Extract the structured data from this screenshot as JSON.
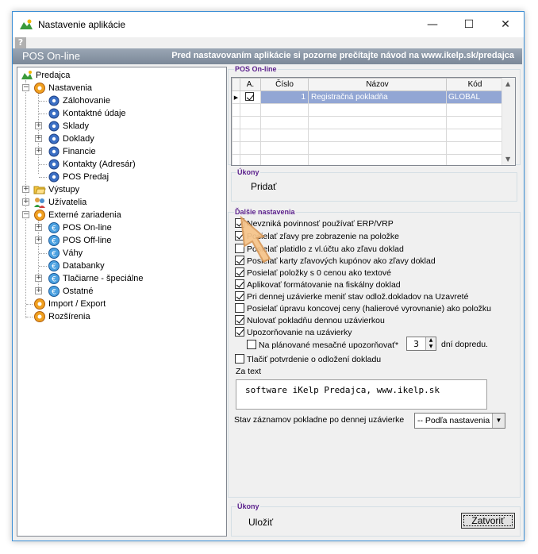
{
  "window": {
    "title": "Nastavenie aplikácie",
    "controls": {
      "minimize": "—",
      "maximize": "☐",
      "close": "✕"
    },
    "help": "?"
  },
  "banner": {
    "left": "POS On-line",
    "right": "Pred nastavovaním aplikácie si pozorne prečítajte návod na www.ikelp.sk/predajca"
  },
  "tree": [
    {
      "label": "Predajca"
    },
    {
      "label": "Nastavenia"
    },
    {
      "label": "Zálohovanie"
    },
    {
      "label": "Kontaktné údaje"
    },
    {
      "label": "Sklady"
    },
    {
      "label": "Doklady"
    },
    {
      "label": "Financie"
    },
    {
      "label": "Kontakty (Adresár)"
    },
    {
      "label": "POS Predaj"
    },
    {
      "label": "Výstupy"
    },
    {
      "label": "Užívatelia"
    },
    {
      "label": "Externé zariadenia"
    },
    {
      "label": "POS On-line"
    },
    {
      "label": "POS Off-line"
    },
    {
      "label": "Váhy"
    },
    {
      "label": "Databanky"
    },
    {
      "label": "Tlačiarne - špeciálne"
    },
    {
      "label": "Ostatné"
    },
    {
      "label": "Import / Export"
    },
    {
      "label": "Rozšírenia"
    }
  ],
  "pos_online": {
    "group_title": "POS On-line",
    "columns": [
      "A.",
      "Číslo",
      "Názov",
      "Kód"
    ],
    "rows": [
      {
        "cislo": "1",
        "nazov": "Registračná pokladňa",
        "kod": "GLOBAL",
        "active": true
      }
    ]
  },
  "ukony_top": {
    "title": "Úkony",
    "add": "Pridať"
  },
  "dalsie": {
    "title": "Ďalšie nastavenia",
    "options": [
      {
        "label": "Nevzniká povinnosť používať ERP/VRP",
        "checked": true
      },
      {
        "label": "Posielať zľavy pre zobrazenie na položke",
        "checked": true
      },
      {
        "label": "Posielať platidlo z vl.účtu ako zľavu doklad",
        "checked": false
      },
      {
        "label": "Posielať karty zľavových kupónov ako zľavy doklad",
        "checked": true
      },
      {
        "label": "Posielať položky s 0 cenou ako textové",
        "checked": true
      },
      {
        "label": "Aplikovať formátovanie na fiskálny doklad",
        "checked": true
      },
      {
        "label": "Pri dennej uzávierke meniť stav odlož.dokladov na Uzavreté",
        "checked": true
      },
      {
        "label": "Posielať úpravu koncovej ceny (halierové vyrovnanie) ako položku",
        "checked": false
      },
      {
        "label": "Nulovať pokladňu dennou uzávierkou",
        "checked": true
      },
      {
        "label": "Upozorňovanie na uzávierky",
        "checked": true
      }
    ],
    "monthly_label": "Na plánované mesačné upozorňovať*",
    "monthly_value": "3",
    "monthly_suffix": "dní dopredu.",
    "print_label": "Tlačiť potvrdenie o odložení dokladu",
    "za_text_label": "Za text",
    "za_text_value": "software iKelp Predajca, www.ikelp.sk",
    "stav_label": "Stav záznamov pokladne po dennej uzávierke",
    "stav_value": "-- Podľa nastavenia"
  },
  "ukony_bottom": {
    "title": "Úkony",
    "save": "Uložiť",
    "close": "Zatvoriť"
  }
}
